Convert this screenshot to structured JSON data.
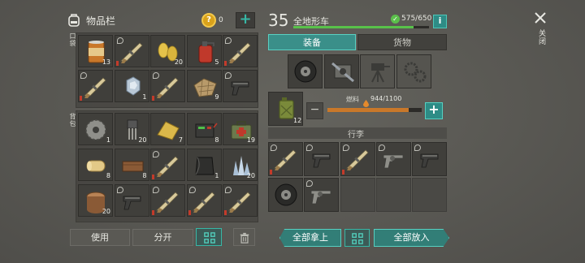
{
  "inventory": {
    "title": "物品栏",
    "coins": "0",
    "add_symbol": "+"
  },
  "sections": {
    "pockets": "口袋",
    "backpack": "背包"
  },
  "pocket_items": [
    {
      "icon": "canned-food-icon",
      "count": "13"
    },
    {
      "icon": "shotgun-icon",
      "count": ""
    },
    {
      "icon": "corn-icon",
      "count": "20"
    },
    {
      "icon": "gas-canister-icon",
      "count": "5"
    },
    {
      "icon": "shotgun-icon",
      "count": ""
    },
    {
      "icon": "shotgun-icon",
      "count": ""
    },
    {
      "icon": "ice-crystal-icon",
      "count": "1"
    },
    {
      "icon": "shotgun-icon",
      "count": ""
    },
    {
      "icon": "rope-net-icon",
      "count": "9"
    },
    {
      "icon": "pistol-icon",
      "count": ""
    }
  ],
  "backpack_items": [
    {
      "icon": "saw-blade-icon",
      "count": "1"
    },
    {
      "icon": "transistor-icon",
      "count": "20"
    },
    {
      "icon": "cloth-icon",
      "count": "7"
    },
    {
      "icon": "battery-icon",
      "count": "8"
    },
    {
      "icon": "first-aid-kit-icon",
      "count": "19"
    },
    {
      "icon": "paper-roll-icon",
      "count": "8"
    },
    {
      "icon": "wood-plank-icon",
      "count": "8"
    },
    {
      "icon": "shotgun-icon",
      "count": ""
    },
    {
      "icon": "metal-sheet-icon",
      "count": "1"
    },
    {
      "icon": "crystal-cluster-icon",
      "count": "20"
    },
    {
      "icon": "log-icon",
      "count": "20"
    },
    {
      "icon": "pistol-icon",
      "count": ""
    },
    {
      "icon": "shotgun-icon",
      "count": ""
    },
    {
      "icon": "shotgun-icon",
      "count": ""
    },
    {
      "icon": "shotgun-icon",
      "count": ""
    }
  ],
  "actions": {
    "use": "使用",
    "split": "分开"
  },
  "vehicle": {
    "level": "35",
    "name": "全地形车",
    "hp": "575/650",
    "info": "i",
    "hp_fraction": 0.885
  },
  "tabs": {
    "equipment": "装备",
    "cargo": "货物"
  },
  "equipment_slots": [
    "tire-icon",
    "engine-part-icon",
    "turret-icon",
    "gears-icon"
  ],
  "fuel": {
    "label": "燃料",
    "value": "944/1100",
    "item_count": "12",
    "minus": "−",
    "plus": "+",
    "fill_fraction": 0.858
  },
  "luggage": {
    "title": "行李",
    "items": [
      {
        "icon": "shotgun-icon",
        "count": ""
      },
      {
        "icon": "pistol-icon",
        "count": ""
      },
      {
        "icon": "shotgun-icon",
        "count": ""
      },
      {
        "icon": "revolver-icon",
        "count": ""
      },
      {
        "icon": "pistol-icon",
        "count": ""
      },
      {
        "icon": "tire-icon",
        "count": ""
      },
      {
        "icon": "revolver-icon",
        "count": ""
      }
    ]
  },
  "bottom": {
    "take_all": "全部拿上",
    "put_all": "全部放入"
  },
  "close": {
    "label": "关闭"
  }
}
